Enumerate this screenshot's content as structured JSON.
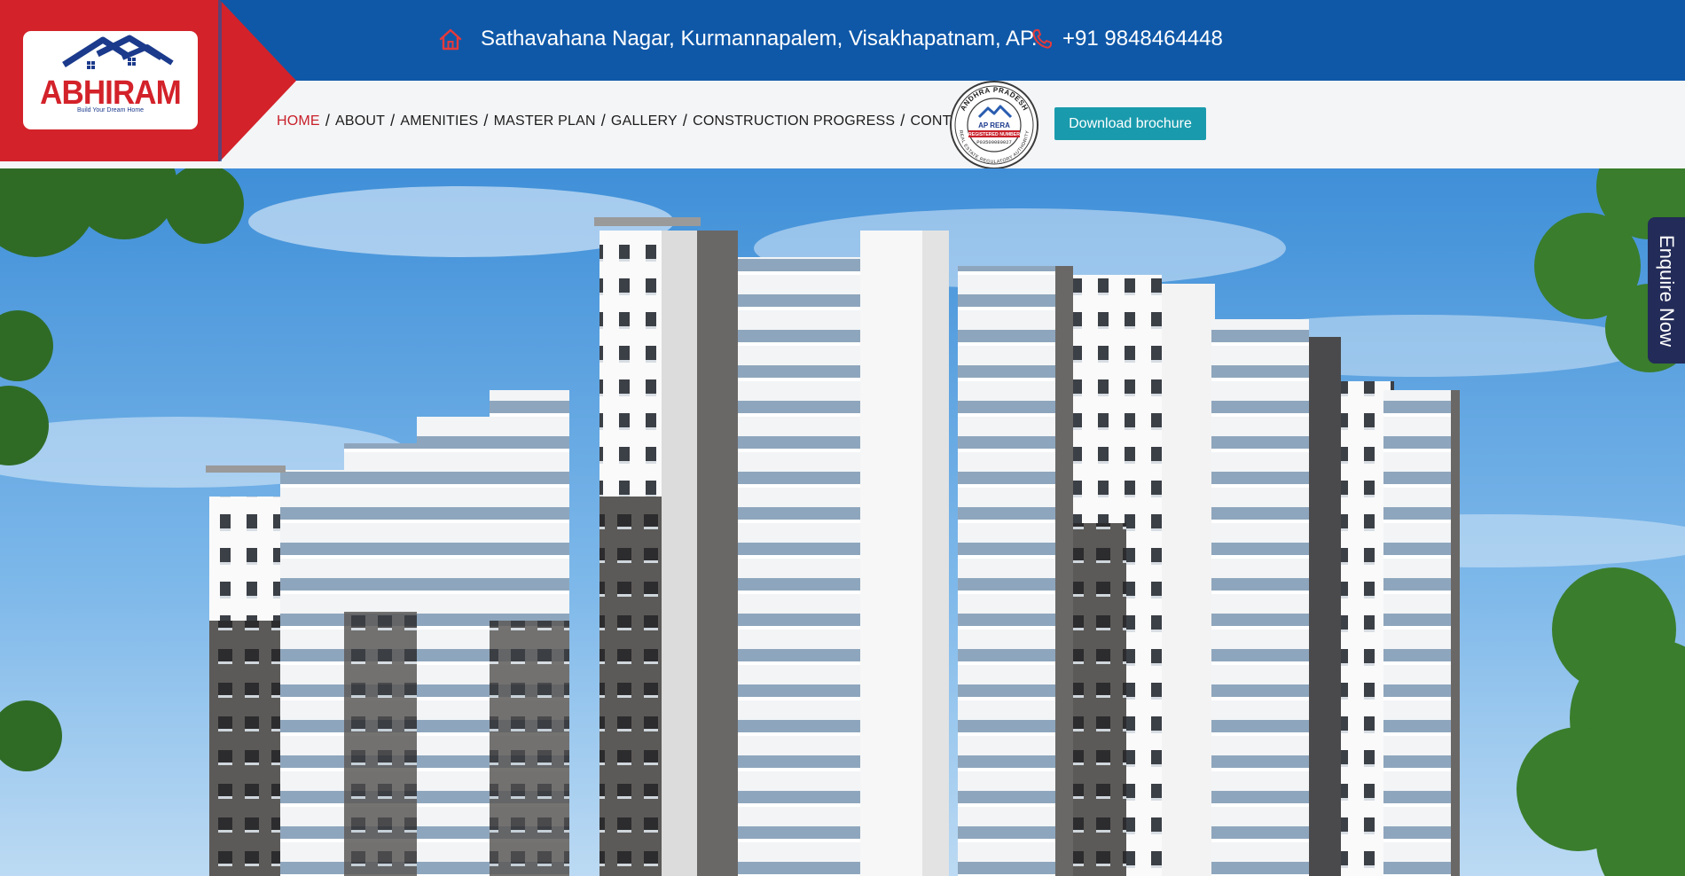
{
  "brand": {
    "name": "ABHIRAM",
    "tagline": "Build Your Dream Home",
    "colors": {
      "red": "#d3222a",
      "blue": "#0f58a8",
      "teal": "#1a9bad",
      "navy": "#232b58"
    }
  },
  "topbar": {
    "address_icon": "home-icon",
    "address": "Sathavahana Nagar, Kurmannapalem, Visakhapatnam, AP.",
    "phone_icon": "phone-icon",
    "phone": "+91 9848464448"
  },
  "nav": {
    "items": [
      {
        "label": "HOME",
        "active": true
      },
      {
        "label": "ABOUT",
        "active": false
      },
      {
        "label": "AMENITIES",
        "active": false
      },
      {
        "label": "MASTER PLAN",
        "active": false
      },
      {
        "label": "GALLERY",
        "active": false
      },
      {
        "label": "CONSTRUCTION PROGRESS",
        "active": false
      },
      {
        "label": "CONTACT",
        "active": false
      }
    ],
    "separator": "/"
  },
  "rera": {
    "top": "ANDHRA PRADESH",
    "title": "AP RERA",
    "badge": "REGISTERED NUMBER",
    "number": "P03500080027",
    "bottom": "REAL ESTATE REGULATORY AUTHORITY"
  },
  "brochure_button": "Download brochure",
  "enquire_tab": "Enquire Now"
}
